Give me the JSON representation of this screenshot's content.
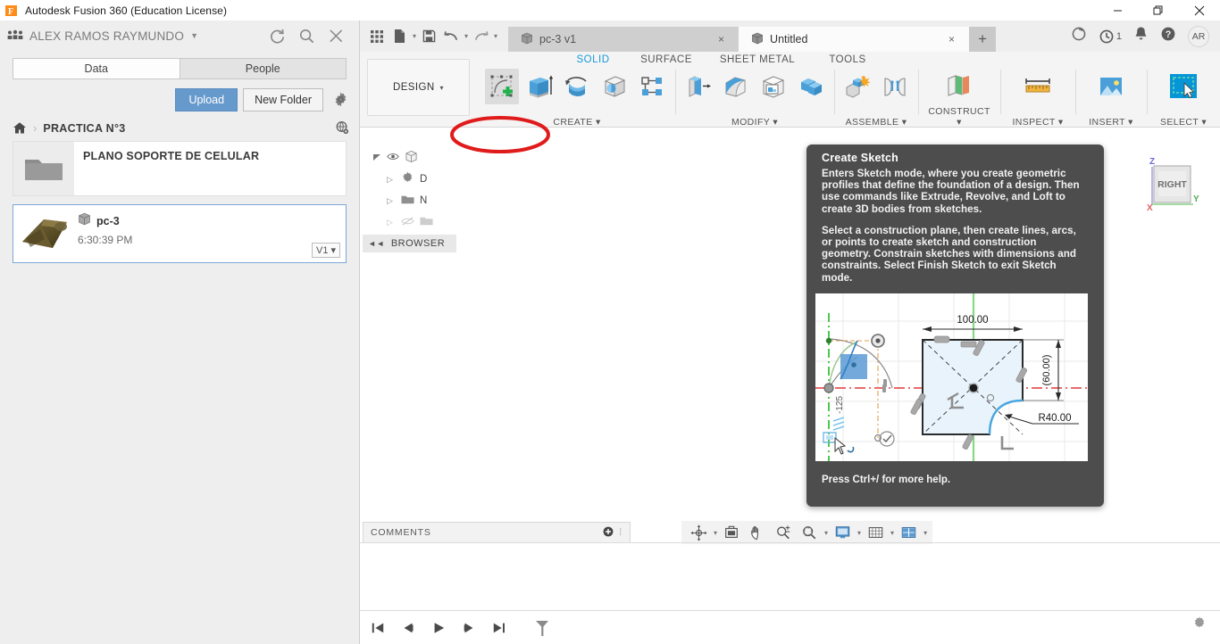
{
  "window": {
    "app_title": "Autodesk Fusion 360 (Education License)",
    "minimize": "–",
    "maximize": "❐",
    "close": "×"
  },
  "left_panel": {
    "user_name": "ALEX RAMOS RAYMUNDO",
    "user_caret": "▼",
    "head_icons": [
      "refresh-icon",
      "search-icon",
      "close-icon"
    ],
    "tabs": [
      {
        "label": "Data",
        "active": true
      },
      {
        "label": "People",
        "active": false
      }
    ],
    "upload_label": "Upload",
    "new_folder_label": "New Folder",
    "breadcrumb": {
      "home": "home-icon",
      "separator": "›",
      "current": "PRACTICA N°3"
    },
    "folder_item": {
      "name": "PLANO SOPORTE DE CELULAR"
    },
    "file_item": {
      "name": "pc-3",
      "time": "6:30:39 PM",
      "version": "V1",
      "version_caret": "▾"
    }
  },
  "quick_access": {
    "icons": [
      "grid-apps-icon",
      "new-document-icon",
      "save-icon",
      "undo-icon",
      "redo-icon"
    ],
    "caret": "▾",
    "doc_tabs": [
      {
        "label": "pc-3 v1",
        "active": false,
        "close": "×"
      },
      {
        "label": "Untitled",
        "active": true,
        "close": "×"
      }
    ],
    "new_tab": "+",
    "right_icons": [
      "job-status-icon",
      "recent-icon",
      "notification-bell-icon",
      "help-icon"
    ],
    "recent_count": "1",
    "avatar_initials": "AR"
  },
  "ribbon": {
    "workspace_label": "DESIGN",
    "workspace_caret": "▾",
    "tabs": [
      {
        "label": "SOLID",
        "active": true
      },
      {
        "label": "SURFACE",
        "active": false
      },
      {
        "label": "SHEET METAL",
        "active": false
      },
      {
        "label": "TOOLS",
        "active": false
      }
    ],
    "panels": [
      {
        "label": "CREATE",
        "caret": "▾",
        "icons": [
          "create-sketch-icon",
          "extrude-icon",
          "revolve-icon",
          "sweep-icon",
          "pattern-icon"
        ]
      },
      {
        "label": "MODIFY",
        "caret": "▾",
        "icons": [
          "press-pull-icon",
          "fillet-icon",
          "shell-icon",
          "combine-icon"
        ]
      },
      {
        "label": "ASSEMBLE",
        "caret": "▾",
        "icons": [
          "new-component-icon",
          "joint-icon"
        ]
      },
      {
        "label": "CONSTRUCT",
        "caret": "▾",
        "icons": [
          "offset-plane-icon"
        ]
      },
      {
        "label": "INSPECT",
        "caret": "▾",
        "icons": [
          "measure-icon"
        ]
      },
      {
        "label": "INSERT",
        "caret": "▾",
        "icons": [
          "insert-image-icon"
        ]
      },
      {
        "label": "SELECT",
        "caret": "▾",
        "icons": [
          "select-window-icon"
        ]
      }
    ]
  },
  "browser": {
    "collapse_icon": "◄◄",
    "label": "BROWSER",
    "nodes": [
      {
        "icon": "eye-icon",
        "label": ""
      },
      {
        "icon": "document-settings-icon",
        "label": "D"
      },
      {
        "icon": "folder-icon",
        "label": "N"
      },
      {
        "icon": "hidden-folder-icon",
        "label": ""
      }
    ],
    "expander": "▷"
  },
  "view_cube": {
    "face_label": "RIGHT",
    "axis_z": "Z",
    "axis_x": "X",
    "axis_y": "Y"
  },
  "tooltip": {
    "title": "Create Sketch",
    "paragraphs": [
      "Enters Sketch mode, where you create geometric profiles that define the foundation of a design. Then use commands like Extrude, Revolve, and Loft to create 3D bodies from sketches.",
      "Select a construction plane, then create lines, arcs, or points to create sketch and construction geometry. Constrain sketches with dimensions and constraints. Select Finish Sketch to exit Sketch mode."
    ],
    "footer": "Press Ctrl+/ for more help.",
    "illustration": {
      "dim_width": "100.00",
      "dim_height": "(60.00)",
      "dim_radius": "R40.00",
      "dim_angle": "-125"
    }
  },
  "annotation": {
    "shape": "red-ellipse",
    "color": "#e01b1b"
  },
  "bottom": {
    "comments_label": "COMMENTS",
    "comments_add": "⊕",
    "nav_icons": [
      "orbit-icon",
      "look-at-icon",
      "pan-icon",
      "zoom-icon",
      "zoom-window-icon",
      "display-settings-icon",
      "grid-snaps-icon",
      "viewports-icon"
    ],
    "nav_caret": "▾",
    "timeline_icons": [
      "skip-to-beginning-icon",
      "step-back-icon",
      "play-icon",
      "step-forward-icon",
      "skip-to-end-icon",
      "filter-icon"
    ],
    "status_gear": "settings-gear-icon"
  }
}
